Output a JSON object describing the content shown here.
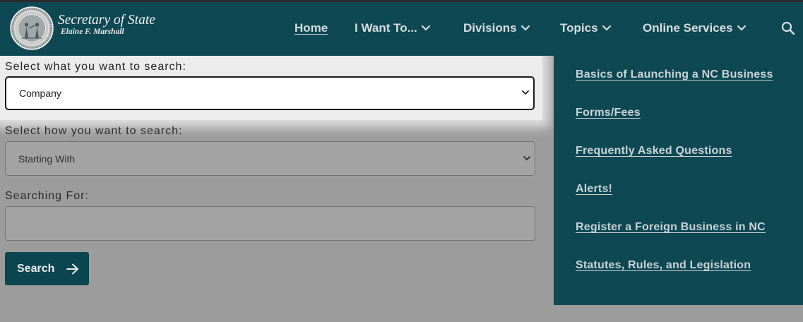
{
  "colors": {
    "brand_teal": "#0d4853",
    "page_overlay": "#9c9c9c",
    "nav_text": "#d6dcdd",
    "menu_link": "#cad3d5",
    "focus_highlight": "#ececec"
  },
  "header": {
    "logo": {
      "icon": "state-seal-icon",
      "title": "Secretary of State",
      "subtitle": "Elaine F. Marshall"
    },
    "nav": [
      {
        "label": "Home",
        "active": true,
        "has_dropdown": false
      },
      {
        "label": "I Want To...",
        "active": false,
        "has_dropdown": true,
        "icon": "chevron-down-icon"
      },
      {
        "label": "Divisions",
        "active": false,
        "has_dropdown": true,
        "icon": "chevron-down-icon"
      },
      {
        "label": "Topics",
        "active": false,
        "has_dropdown": true,
        "icon": "chevron-down-icon"
      },
      {
        "label": "Online Services",
        "active": false,
        "has_dropdown": true,
        "icon": "chevron-down-icon"
      }
    ],
    "search_icon": "search-icon"
  },
  "form": {
    "search_type": {
      "label": "Select what you want to search:",
      "selected": "Company",
      "highlighted": true,
      "icon": "chevron-down-icon"
    },
    "search_method": {
      "label": "Select how you want to search:",
      "selected": "Starting With",
      "icon": "chevron-down-icon"
    },
    "search_for": {
      "label": "Searching For:",
      "value": ""
    },
    "submit": {
      "label": "Search",
      "icon": "arrow-right-icon"
    }
  },
  "dropdown_menu": {
    "items": [
      {
        "label": "Basics of Launching a NC Business"
      },
      {
        "label": "Forms/Fees"
      },
      {
        "label": "Frequently Asked Questions"
      },
      {
        "label": "Alerts!"
      },
      {
        "label": "Register a Foreign Business in NC"
      },
      {
        "label": "Statutes, Rules, and Legislation"
      }
    ]
  }
}
